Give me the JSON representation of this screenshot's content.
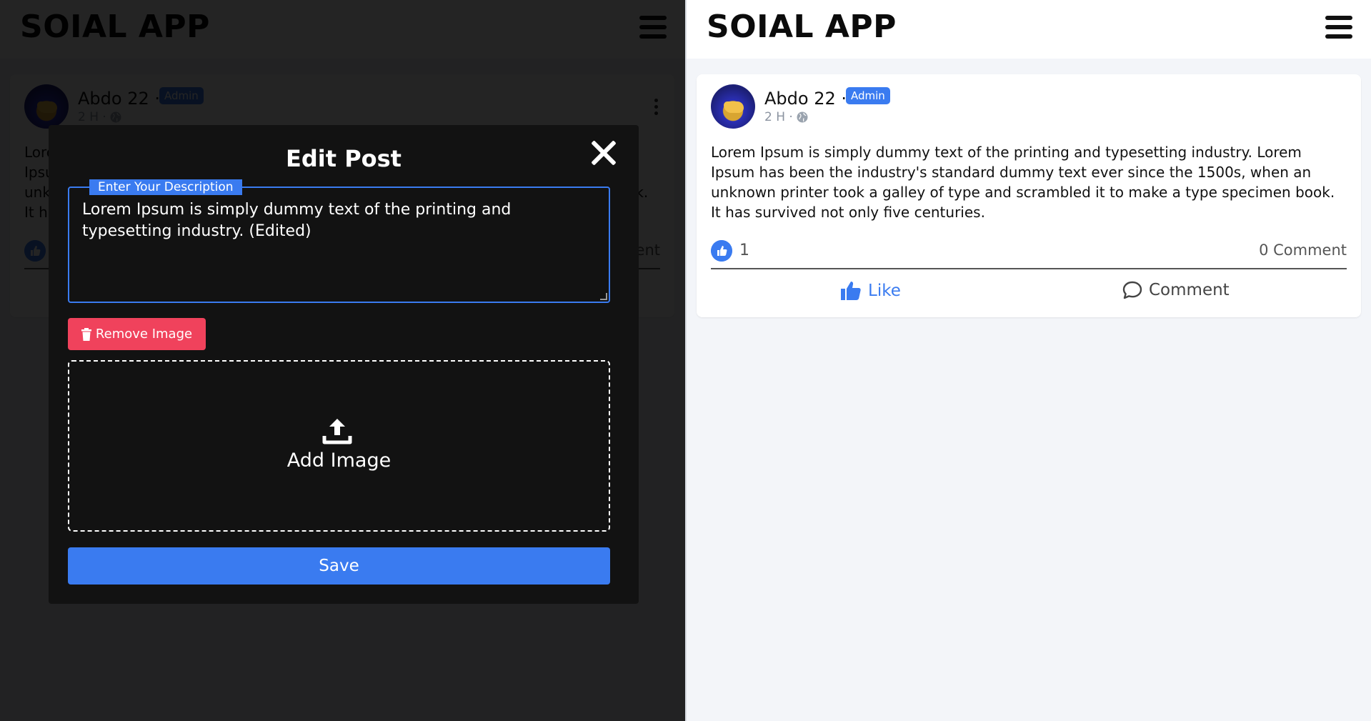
{
  "app": {
    "title": "SOIAL APP"
  },
  "post": {
    "author": "Abdo 22 ·",
    "badge": "Admin",
    "time": "2 H ·",
    "text": "Lorem Ipsum is simply dummy text of the printing and typesetting industry. Lorem Ipsum has been the industry's standard dummy text ever since the 1500s, when an unknown printer took a galley of type and scrambled it to make a type specimen book. It has survived not only five centuries.",
    "like_count": "1",
    "comment_count": "0 Comment",
    "like_label": "Like",
    "comment_label": "Comment"
  },
  "modal": {
    "title": "Edit Post",
    "description_label": "Enter Your Description",
    "description_value": "Lorem Ipsum is simply dummy text of the printing and typesetting industry. (Edited)",
    "remove_image_label": "Remove Image",
    "add_image_label": "Add Image",
    "save_label": "Save"
  },
  "colors": {
    "accent": "#3a7bf0",
    "danger": "#f0425c",
    "overlay": "#000000",
    "modal_bg": "#121212"
  },
  "icons": [
    "menu-icon",
    "globe-icon",
    "more-options-icon",
    "thumbs-up-icon",
    "comment-icon",
    "close-icon",
    "trash-icon",
    "upload-icon"
  ]
}
